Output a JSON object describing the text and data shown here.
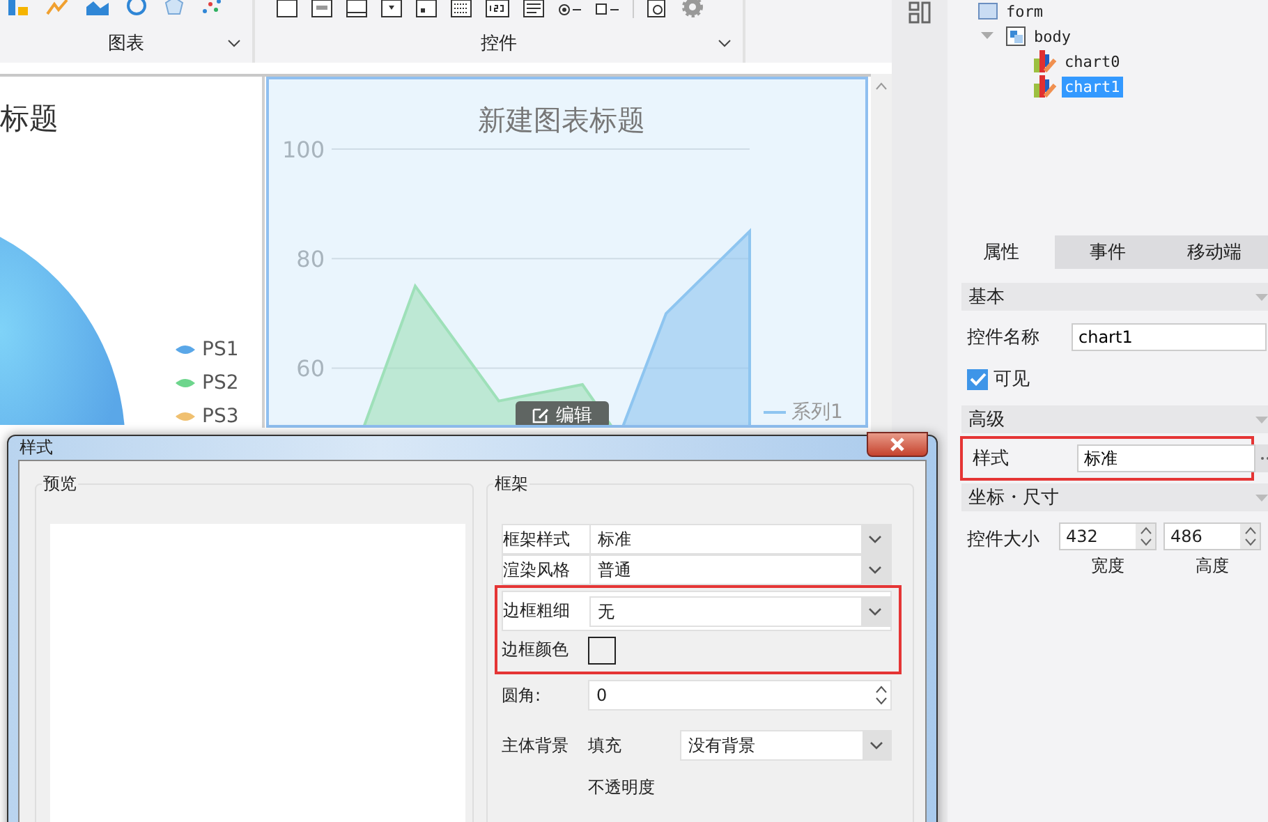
{
  "toolbar": {
    "groups": [
      {
        "label": "图表"
      },
      {
        "label": "控件"
      }
    ]
  },
  "canvas": {
    "charts": [
      {
        "kind": "pie",
        "title": "标题",
        "selected": false,
        "legend": [
          {
            "label": "PS1",
            "color": "#5aa7e8"
          },
          {
            "label": "PS2",
            "color": "#6dd58c"
          },
          {
            "label": "PS3",
            "color": "#f0c070"
          }
        ]
      },
      {
        "kind": "area",
        "selected": true,
        "title": "新建图表标题",
        "axis_labels": [
          "100",
          "80",
          "60"
        ],
        "edit_button": "编辑",
        "legend": [
          {
            "label": "系列1",
            "color": "#8ec5f0"
          }
        ]
      }
    ]
  },
  "structure_tree": {
    "items": [
      {
        "label": "form",
        "selected": false,
        "children": [
          {
            "label": "body",
            "selected": false,
            "expanded": true,
            "children": [
              {
                "label": "chart0",
                "selected": false
              },
              {
                "label": "chart1",
                "selected": true
              }
            ]
          }
        ]
      }
    ]
  },
  "properties_panel": {
    "tabs": [
      {
        "label": "属性",
        "selected": true
      },
      {
        "label": "事件",
        "selected": false
      },
      {
        "label": "移动端",
        "selected": false
      }
    ],
    "sections": [
      {
        "title": "基本",
        "rows": [
          {
            "kind": "text",
            "label": "控件名称",
            "value": "chart1",
            "highlighted": false
          },
          {
            "kind": "checkbox",
            "label": "可见",
            "checked": true,
            "highlighted": false
          }
        ]
      },
      {
        "title": "高级",
        "rows": [
          {
            "kind": "text",
            "label": "样式",
            "value": "标准",
            "highlighted": true,
            "more_button": true
          }
        ]
      },
      {
        "title": "坐标・尺寸",
        "rows": [
          {
            "kind": "size",
            "label": "控件大小",
            "highlighted": false,
            "fields": [
              {
                "value": "432",
                "caption": "宽度"
              },
              {
                "value": "486",
                "caption": "高度"
              }
            ]
          }
        ]
      }
    ]
  },
  "dialog": {
    "title": "样式",
    "preview": {
      "title": "预览"
    },
    "frame": {
      "title": "框架",
      "rows": [
        {
          "kind": "select",
          "label": "框架样式",
          "value": "标准",
          "highlighted": false
        },
        {
          "kind": "select",
          "label": "渲染风格",
          "value": "普通",
          "highlighted": false
        },
        {
          "kind": "select",
          "label": "边框粗细",
          "value": "无",
          "highlighted": true
        },
        {
          "kind": "color",
          "label": "边框颜色",
          "highlighted": true
        },
        {
          "kind": "spinner",
          "label": "圆角:",
          "value": "0",
          "highlighted": false
        },
        {
          "kind": "fill",
          "label": "主体背景",
          "sublabel": "填充",
          "value": "没有背景",
          "highlighted": false
        },
        {
          "kind": "note",
          "label": "不透明度",
          "highlighted": false
        }
      ]
    }
  }
}
